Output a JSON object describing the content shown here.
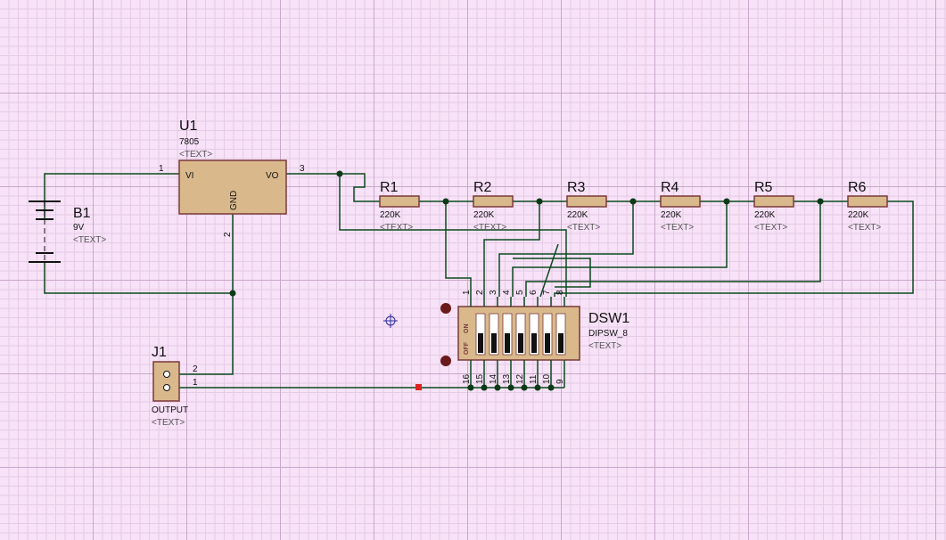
{
  "components": {
    "U1": {
      "ref": "U1",
      "value": "7805",
      "text": "<TEXT>",
      "pin_vi": "VI",
      "pin_vo": "VO",
      "pin_gnd": "GND",
      "pin1": "1",
      "pin2": "2",
      "pin3": "3"
    },
    "B1": {
      "ref": "B1",
      "value": "9V",
      "text": "<TEXT>"
    },
    "J1": {
      "ref": "J1",
      "value": "OUTPUT",
      "text": "<TEXT>",
      "pin1": "1",
      "pin2": "2"
    },
    "DSW1": {
      "ref": "DSW1",
      "value": "DIPSW_8",
      "text": "<TEXT>",
      "on_label": "ON",
      "off_label": "OFF"
    },
    "resistors": [
      {
        "ref": "R1",
        "value": "220K",
        "text": "<TEXT>"
      },
      {
        "ref": "R2",
        "value": "220K",
        "text": "<TEXT>"
      },
      {
        "ref": "R3",
        "value": "220K",
        "text": "<TEXT>"
      },
      {
        "ref": "R4",
        "value": "220K",
        "text": "<TEXT>"
      },
      {
        "ref": "R5",
        "value": "220K",
        "text": "<TEXT>"
      },
      {
        "ref": "R6",
        "value": "220K",
        "text": "<TEXT>"
      }
    ],
    "dip_top_pins": [
      "1",
      "2",
      "3",
      "4",
      "5",
      "6",
      "7",
      "8"
    ],
    "dip_bottom_pins": [
      "16",
      "15",
      "14",
      "13",
      "12",
      "11",
      "10",
      "9"
    ]
  },
  "colors": {
    "background": "#f7e2f7",
    "wire": "#0b4a1e",
    "component_body": "#d9b98c",
    "component_outline": "#7a3a3a",
    "junction": "#0b3a14"
  }
}
